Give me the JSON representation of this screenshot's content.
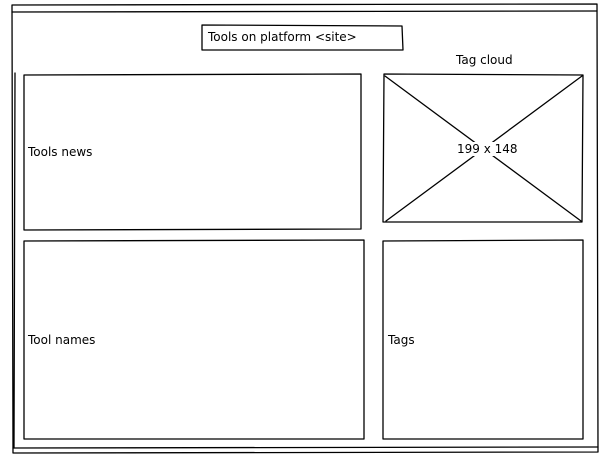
{
  "header": {
    "title": "Tools on platform <site>"
  },
  "tools_news": {
    "label": "Tools news"
  },
  "tag_cloud": {
    "caption": "Tag cloud",
    "placeholder_size": "199 x 148"
  },
  "tool_names": {
    "label": "Tool names"
  },
  "tags": {
    "label": "Tags"
  }
}
